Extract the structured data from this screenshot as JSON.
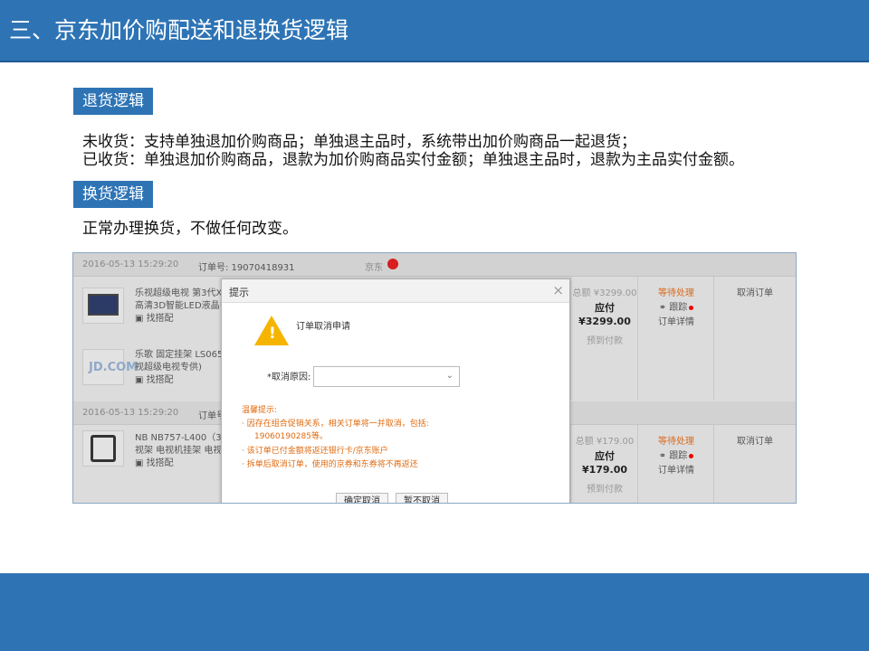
{
  "slide": {
    "title": "三、京东加价购配送和退换货逻辑",
    "return_label": "退货逻辑",
    "return_lines": [
      "未收货：支持单独退加价购商品；单独退主品时，系统带出加价购商品一起退货；",
      "已收货：单独退加价购商品，退款为加价购商品实付金额；单独退主品时，退款为主品实付金额。"
    ],
    "exchange_label": "换货逻辑",
    "exchange_line": "正常办理换货，不做任何改变。"
  },
  "orders": [
    {
      "date": "2016-05-13 15:29:20",
      "order_no": "订单号: 19070418931",
      "shop": "京东",
      "items": [
        {
          "name_1": "乐视超级电视 第3代X50",
          "name_2": "高清3D智能LED液晶电",
          "tag": "找搭配"
        },
        {
          "logo": "JD.COM",
          "name_1": "乐歌 固定挂架 LS065N",
          "name_2": "视超级电视专供)",
          "tag": "找搭配"
        }
      ],
      "total": "总额 ¥3299.00",
      "pay_label": "应付",
      "pay_amount": "¥3299.00",
      "pay_method": "预到付款",
      "status": "等待处理",
      "track": "跟踪",
      "detail": "订单详情",
      "action": "取消订单"
    },
    {
      "date": "2016-05-13 15:29:20",
      "order_no": "订单号",
      "items": [
        {
          "name_1": "NB NB757-L400（32-6",
          "name_2": "视架 电视机挂架 电视支",
          "tag": "找搭配"
        }
      ],
      "total": "总额 ¥179.00",
      "pay_label": "应付",
      "pay_amount": "¥179.00",
      "pay_method": "预到付款",
      "status": "等待处理",
      "track": "跟踪",
      "detail": "订单详情",
      "action": "取消订单"
    }
  ],
  "dialog": {
    "title": "提示",
    "close": "×",
    "heading": "订单取消申请",
    "reason_label": "*取消原因:",
    "reason_value": "",
    "tips_title": "温馨提示:",
    "tips": [
      "·  因存在组合促销关系，相关订单将一并取消，包括:",
      "19060190285等。",
      "·  该订单已付金额将返还银行卡/京东账户",
      "·  拆单后取消订单，使用的京券和东券将不再返还"
    ],
    "confirm": "确定取消",
    "cancel": "暂不取消"
  },
  "colors": {
    "theme_blue": "#2e74b5",
    "orange": "#d8691b",
    "warning": "#f5b400"
  }
}
